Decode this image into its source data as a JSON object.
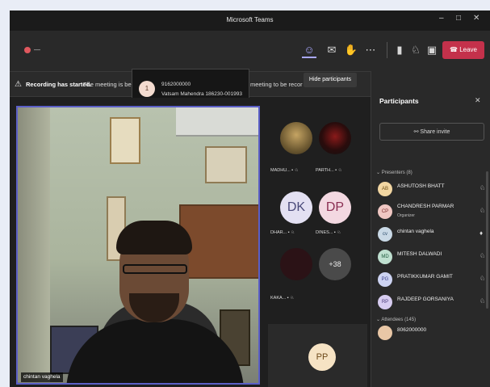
{
  "window": {
    "title": "Microsoft Teams"
  },
  "toolbar": {
    "timer": "—",
    "leave_label": "Leave"
  },
  "banner": {
    "strong": "Recording has started.",
    "text_left": "The meeting is being",
    "text_right": "meeting to be recor"
  },
  "popup": {
    "number": "1",
    "line1": "9162000000",
    "line2": "Vatsam Mahendra 186230-001993"
  },
  "tooltip": {
    "text": "Hide participants"
  },
  "main_video": {
    "name": "chintan vaghela"
  },
  "tiles": {
    "t1_label": "MADHU... ▪ ♘",
    "t2_label": "PARTH... ▪ ♘",
    "t3_initials": "DK",
    "t3_label": "DHAR... ▪ ♘",
    "t4_initials": "DP",
    "t4_label": "DINES... ▪ ♘",
    "t5_label": "KAKA... ▪ ♘",
    "t6_initials": "+38",
    "pp_initials": "PP"
  },
  "panel": {
    "title": "Participants",
    "share_label": "Share invite",
    "presenters_label": "Presenters (8)",
    "attendees_label": "Attendees (145)",
    "people": [
      {
        "initials": "AB",
        "name": "ASHUTOSH BHATT",
        "role": "",
        "color": "#f2d6a2"
      },
      {
        "initials": "CP",
        "name": "CHANDRESH PARMAR",
        "role": "Organizer",
        "color": "#f0c7c3"
      },
      {
        "initials": "cv",
        "name": "chintan vaghela",
        "role": "",
        "color": "#c9d9e6"
      },
      {
        "initials": "MD",
        "name": "MITESH DALWADI",
        "role": "",
        "color": "#bfe0d0"
      },
      {
        "initials": "PG",
        "name": "PRATIKKUMAR GAMIT",
        "role": "",
        "color": "#cdd3f2"
      },
      {
        "initials": "RP",
        "name": "RAJDEEP GORSANIYA",
        "role": "",
        "color": "#d7ccf0"
      },
      {
        "initials": "",
        "name": "8062000000",
        "role": "",
        "color": "#e9c7a6"
      }
    ]
  }
}
